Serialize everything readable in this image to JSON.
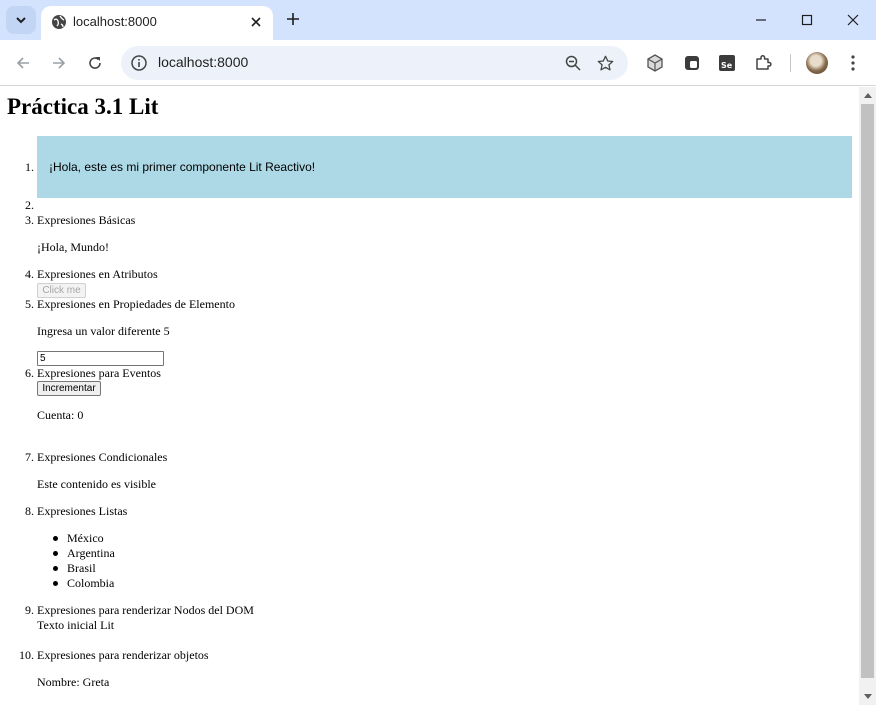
{
  "browser": {
    "tab_title": "localhost:8000",
    "url": "localhost:8000"
  },
  "page": {
    "heading": "Práctica 3.1 Lit",
    "items": [
      {
        "num": "1.",
        "text": "¡Hola, este es mi primer componente Lit Reactivo!"
      },
      {
        "num": "2.",
        "text": ""
      },
      {
        "num": "3.",
        "label": "Expresiones Básicas",
        "content": "¡Hola, Mundo!"
      },
      {
        "num": "4.",
        "label": "Expresiones en Atributos",
        "button_label": "Click me"
      },
      {
        "num": "5.",
        "label": "Expresiones en Propiedades de Elemento",
        "content": "Ingresa un valor diferente 5",
        "input_value": "5"
      },
      {
        "num": "6.",
        "label": "Expresiones para Eventos",
        "button_label": "Incrementar",
        "content": "Cuenta: 0"
      },
      {
        "num": "7.",
        "label": "Expresiones Condicionales",
        "content": "Este contenido es visible"
      },
      {
        "num": "8.",
        "label": "Expresiones Listas",
        "list": [
          "México",
          "Argentina",
          "Brasil",
          "Colombia"
        ]
      },
      {
        "num": "9.",
        "label": "Expresiones para renderizar Nodos del DOM",
        "content": "Texto inicial Lit"
      },
      {
        "num": "10.",
        "label": "Expresiones para renderizar objetos",
        "content": "Nombre: Greta"
      }
    ]
  }
}
